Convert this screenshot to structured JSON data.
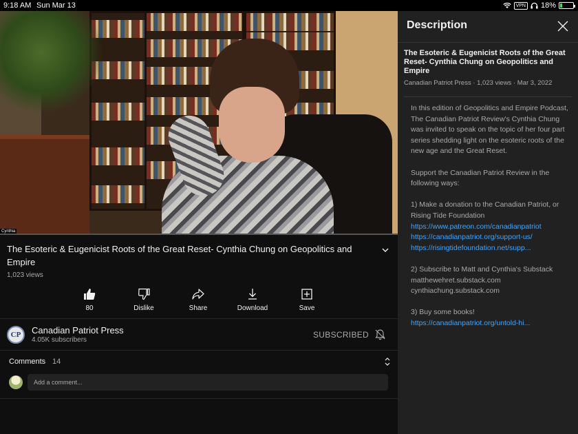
{
  "status_bar": {
    "time": "9:18 AM",
    "date": "Sun Mar 13",
    "vpn": "VPN",
    "battery": "18%",
    "battery_level": 0.18
  },
  "video": {
    "speaker_label": "Cynthia",
    "progress": 0.0
  },
  "title": "The Esoteric & Eugenicist Roots of the Great Reset- Cynthia Chung on Geopolitics and Empire",
  "views": "1,023 views",
  "actions": {
    "like_count": "80",
    "dislike": "Dislike",
    "share": "Share",
    "download": "Download",
    "save": "Save"
  },
  "channel": {
    "avatar_text": "CP",
    "name": "Canadian Patriot Press",
    "subscribers": "4.05K subscribers",
    "subscribe_state": "SUBSCRIBED"
  },
  "comments": {
    "label": "Comments",
    "count": "14",
    "placeholder": "Add a comment..."
  },
  "description": {
    "header": "Description",
    "title": "The Esoteric & Eugenicist Roots of the Great Reset- Cynthia Chung on Geopolitics and Empire",
    "meta": "Canadian Patriot Press · 1,023 views · Mar 3, 2022",
    "para1": "In this edition of Geopolitics and Empire Podcast, The Canadian Patriot Review's Cynthia Chung was invited to speak on the topic of her four part series shedding light on the esoteric roots of the new age and the Great Reset.",
    "para2": "Support the Canadian Patriot Review in the following ways:",
    "item1": "1) Make a donation to the Canadian Patriot, or Rising Tide Foundation",
    "link1": "https://www.patreon.com/canadianpatriot",
    "link2": "https://canadianpatriot.org/support-us/",
    "link3": "https://risingtidefoundation.net/supp...",
    "item2": "2) Subscribe to Matt and Cynthia's Substack",
    "substack1": "matthewehret.substack.com",
    "substack2": "cynthiachung.substack.com",
    "item3": "3) Buy some books!",
    "link4": "https://canadianpatriot.org/untold-hi..."
  }
}
